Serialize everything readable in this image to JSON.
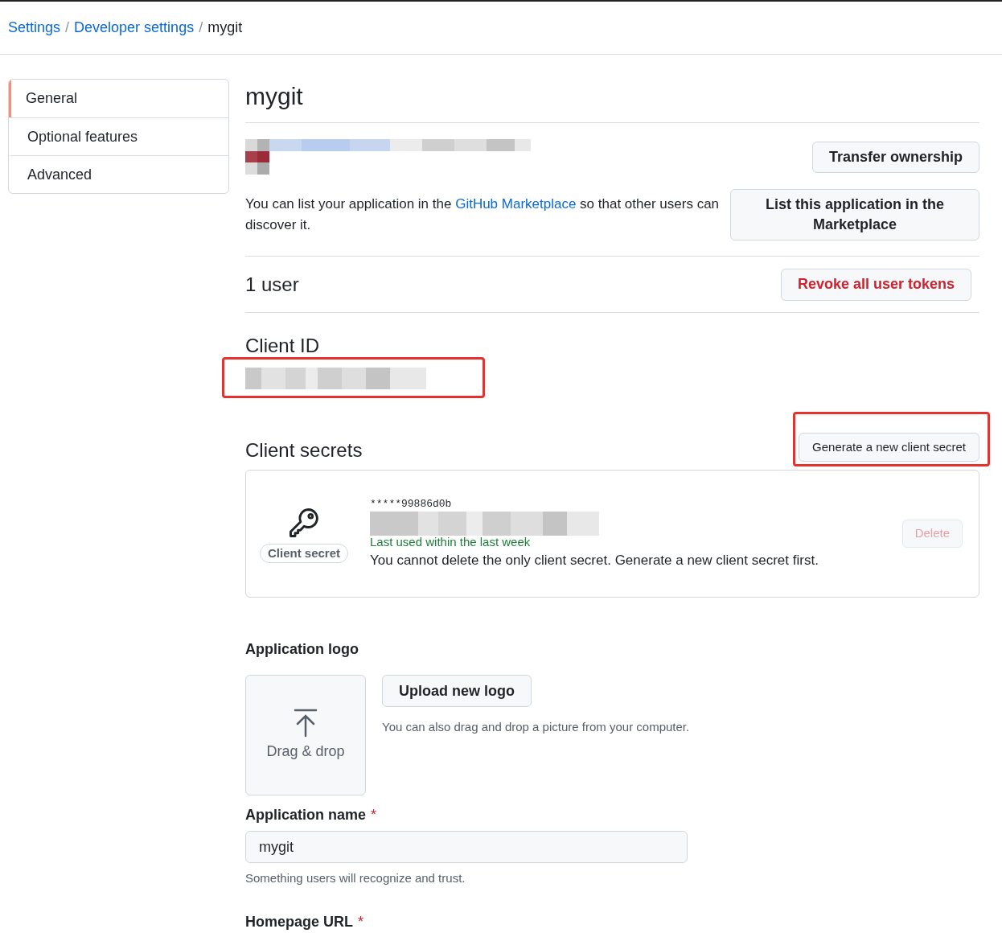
{
  "breadcrumb": [
    {
      "label": "Settings",
      "link": true
    },
    {
      "separator": "/",
      "label": "Developer settings",
      "link": true
    },
    {
      "separator": "/",
      "label": "mygit",
      "link": false
    }
  ],
  "sidebar": {
    "items": [
      {
        "label": "General",
        "selected": true
      },
      {
        "label": "Optional features",
        "selected": false
      },
      {
        "label": "Advanced",
        "selected": false
      }
    ]
  },
  "title": "mygit",
  "owner": {
    "button": "Transfer ownership"
  },
  "marketplace": {
    "text": "You can list your application in the ",
    "link": "GitHub Marketplace",
    "text_after": " so that other users can discover it.",
    "button": "List this application in the Marketplace"
  },
  "users": {
    "heading": "1 user",
    "button": "Revoke all user tokens"
  },
  "client_id": {
    "heading": "Client ID"
  },
  "client_secrets": {
    "heading": "Client secrets",
    "button": "Generate a new client secret",
    "secrets": [
      {
        "badge": "Client secret",
        "secret": "*****99886d0b",
        "last_used": "Last used within the last week",
        "note": "You cannot delete the only client secret. Generate a new client secret first.",
        "delete": "Delete",
        "disabled": true
      }
    ]
  },
  "logo": {
    "heading": "Application logo",
    "drop": "Drag & drop",
    "button": "Upload new logo",
    "help": "You can also drag and drop a picture from your computer."
  },
  "fields": [
    {
      "label": "Application name",
      "required_mark": "*",
      "value": "mygit",
      "hint": "Something users will recognize and trust."
    },
    {
      "label": "Homepage URL",
      "required_mark": "*"
    }
  ]
}
